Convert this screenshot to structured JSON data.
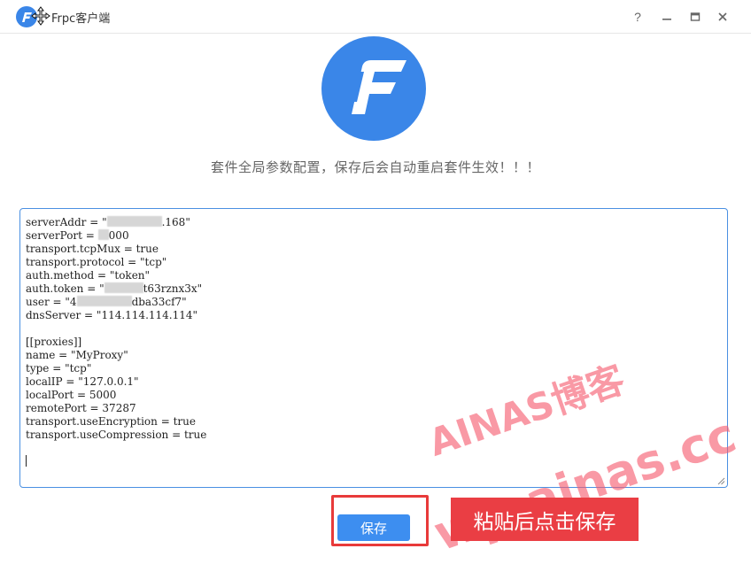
{
  "window": {
    "title": "Frpc客户端",
    "help_label": "?"
  },
  "notice": "套件全局参数配置，保存后会自动重启套件生效！！！",
  "config": {
    "lines": [
      {
        "pre": "serverAddr = \"",
        "redact": 62,
        "post": ".168\""
      },
      {
        "pre": "serverPort = ",
        "redact": 12,
        "post": "000"
      },
      {
        "pre": "transport.tcpMux = true"
      },
      {
        "pre": "transport.protocol = \"tcp\""
      },
      {
        "pre": "auth.method = \"token\""
      },
      {
        "pre": "auth.token = \"",
        "redact": 44,
        "post": "t63rznx3x\""
      },
      {
        "pre": "user = \"4",
        "redact": 62,
        "post": "dba33cf7\""
      },
      {
        "pre": "dnsServer = \"114.114.114.114\""
      },
      {
        "pre": ""
      },
      {
        "pre": "[[proxies]]"
      },
      {
        "pre": "name = \"MyProxy\""
      },
      {
        "pre": "type = \"tcp\""
      },
      {
        "pre": "localIP = \"127.0.0.1\""
      },
      {
        "pre": "localPort = 5000"
      },
      {
        "pre": "remotePort = 37287"
      },
      {
        "pre": "transport.useEncryption = true"
      },
      {
        "pre": "transport.useCompression = true"
      },
      {
        "pre": ""
      },
      {
        "pre": "",
        "caret": true
      }
    ]
  },
  "buttons": {
    "save_label": "保存"
  },
  "hint": "粘贴后点击保存",
  "watermark": {
    "line1": "AINAS博客",
    "line2": "wp.ainas.cc"
  },
  "colors": {
    "accent": "#3d8ef0",
    "logo": "#3a86e8",
    "highlight": "#e83a3a",
    "hint_bg": "#ea3e44",
    "watermark": "#f55a6e"
  },
  "icons": {
    "app": "frp-logo-icon",
    "cursor": "move-cursor-icon",
    "minimize": "minimize-icon",
    "maximize": "maximize-icon",
    "close": "close-icon"
  }
}
